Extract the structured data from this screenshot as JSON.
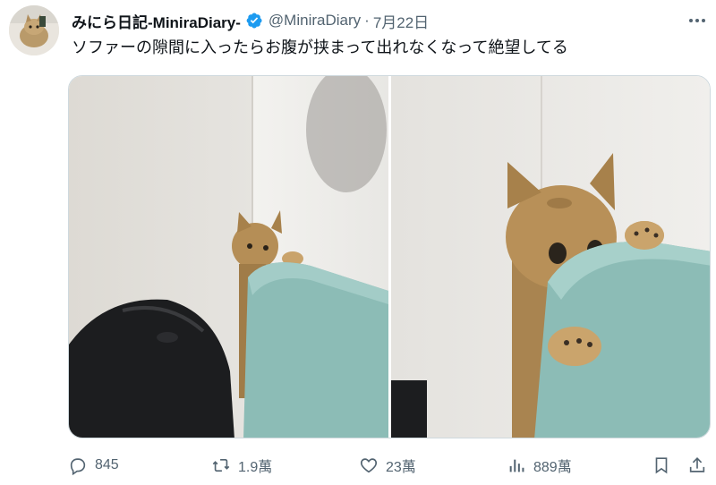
{
  "author": {
    "display_name": "みにら日記-MiniraDiary-",
    "handle": "@MiniraDiary",
    "separator": "·",
    "date": "7月22日",
    "avatar_icon": "cat-avatar",
    "verified_icon": "verified-badge-icon"
  },
  "tweet": {
    "text": "ソファーの隙間に入ったらお腹が挟まって出れなくなって絶望してる"
  },
  "media": {
    "photos": [
      "cat-stuck-behind-sofa-wide",
      "cat-stuck-behind-sofa-closeup"
    ]
  },
  "actions": {
    "reply_count": "845",
    "retweet_count": "1.9萬",
    "like_count": "23萬",
    "views_count": "889萬"
  },
  "colors": {
    "text": "#0f1419",
    "secondary": "#536471",
    "verified": "#1d9bf0",
    "sofa": "#8cbcb6"
  }
}
